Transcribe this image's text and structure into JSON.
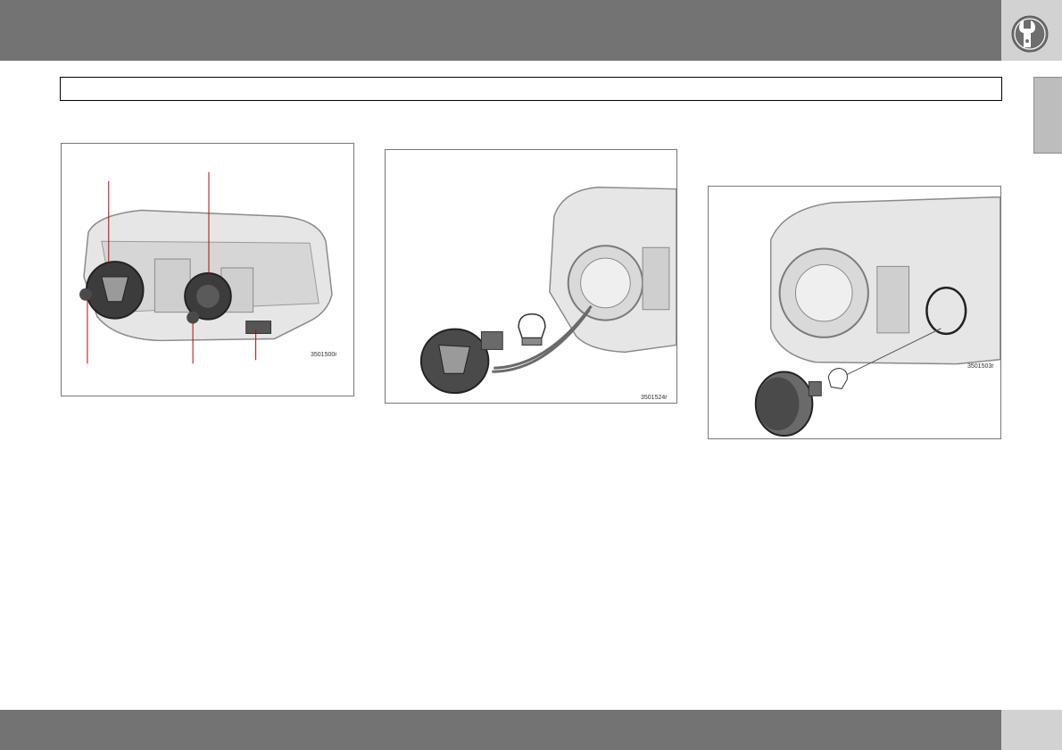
{
  "figures": [
    {
      "code": "3501500r"
    },
    {
      "code": "3501524r"
    },
    {
      "code": "3501503r"
    }
  ],
  "colors": {
    "header": "#737373",
    "corner": "#d2d2d2",
    "callout": "#c00000"
  },
  "icons": {
    "header": "wrench-tools-icon"
  }
}
